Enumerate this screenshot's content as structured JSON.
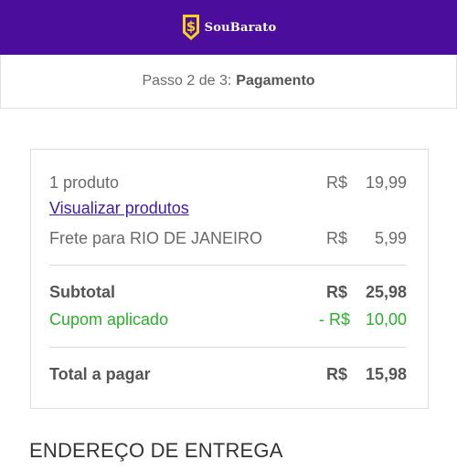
{
  "header": {
    "brand": "SouBarato",
    "logo_icon": "dollar-shield-icon",
    "background": "#4b0e9c",
    "logo_color": "#f4d21e"
  },
  "step": {
    "prefix": "Passo 2 de 3:",
    "current": "Pagamento"
  },
  "summary": {
    "products": {
      "label": "1 produto",
      "currency": "R$",
      "value": "19,99"
    },
    "view_products_link": "Visualizar produtos",
    "shipping": {
      "label": "Frete para RIO DE JANEIRO",
      "currency": "R$",
      "value": "5,99"
    },
    "subtotal": {
      "label": "Subtotal",
      "currency": "R$",
      "value": "25,98"
    },
    "coupon": {
      "label": "Cupom aplicado",
      "currency": "- R$",
      "value": "10,00",
      "color": "#2ab02a"
    },
    "total": {
      "label": "Total a pagar",
      "currency": "R$",
      "value": "15,98"
    }
  },
  "delivery_section": {
    "title": "ENDEREÇO DE ENTREGA"
  }
}
